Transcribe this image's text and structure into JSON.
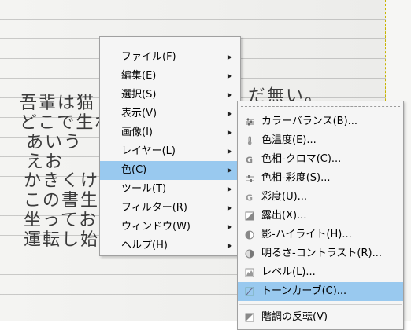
{
  "background": {
    "handwriting_lines": [
      "吾輩は猫",
      "どこで生れ",
      "あいう",
      "えお",
      "かきくけこ",
      "この書生",
      "坐っておっ",
      "運転し始",
      "だ無い。"
    ]
  },
  "main_menu": {
    "items": [
      {
        "label": "ファイル(F)"
      },
      {
        "label": "編集(E)"
      },
      {
        "label": "選択(S)"
      },
      {
        "label": "表示(V)"
      },
      {
        "label": "画像(I)"
      },
      {
        "label": "レイヤー(L)"
      },
      {
        "label": "色(C)"
      },
      {
        "label": "ツール(T)"
      },
      {
        "label": "フィルター(R)"
      },
      {
        "label": "ウィンドウ(W)"
      },
      {
        "label": "ヘルプ(H)"
      }
    ],
    "arrow": "▶"
  },
  "color_submenu": {
    "items": [
      {
        "label": "カラーバランス(B)...",
        "icon": "color-balance-icon"
      },
      {
        "label": "色温度(E)...",
        "icon": "color-temperature-icon"
      },
      {
        "label": "色相-クロマ(C)...",
        "icon": "hue-chroma-icon"
      },
      {
        "label": "色相-彩度(S)...",
        "icon": "hue-saturation-icon"
      },
      {
        "label": "彩度(U)...",
        "icon": "saturation-icon"
      },
      {
        "label": "露出(X)...",
        "icon": "exposure-icon"
      },
      {
        "label": "影-ハイライト(H)...",
        "icon": "shadows-highlights-icon"
      },
      {
        "label": "明るさ-コントラスト(R)...",
        "icon": "brightness-contrast-icon"
      },
      {
        "label": "レベル(L)...",
        "icon": "levels-icon"
      },
      {
        "label": "トーンカーブ(C)...",
        "icon": "curves-icon"
      },
      {
        "label": "階調の反転(V)",
        "icon": "invert-icon"
      }
    ]
  },
  "colors": {
    "highlight": "#99c9ef",
    "menu_bg": "#f5f5f5"
  }
}
